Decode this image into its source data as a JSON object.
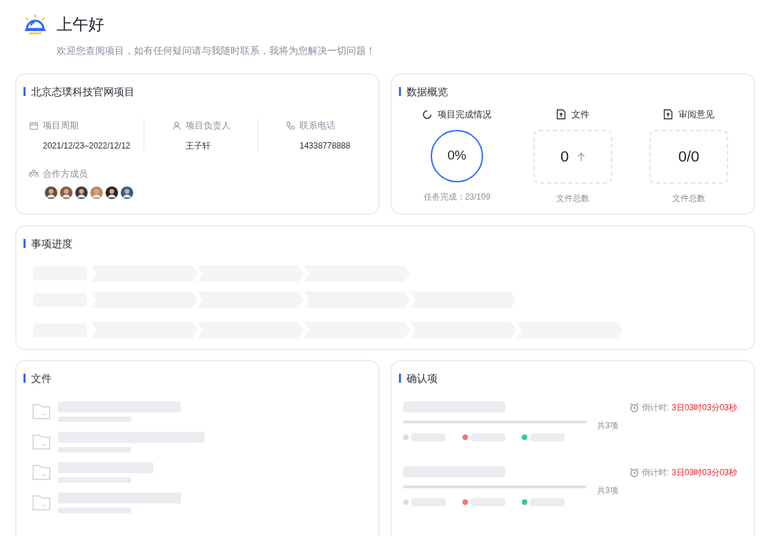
{
  "greeting": {
    "title": "上午好",
    "subtitle": "欢迎您查阅项目，如有任何疑问请与我随时联系，我将为您解决一切问题！"
  },
  "project": {
    "title": "北京态璞科技官网项目",
    "fields": [
      {
        "kind": "calendar",
        "label": "项目周期",
        "value": "2021/12/23–2022/12/12"
      },
      {
        "kind": "person",
        "label": "项目负责人",
        "value": "王子轩"
      },
      {
        "kind": "phone",
        "label": "联系电话",
        "value": "14338778888"
      }
    ],
    "members_label": "合作方成员"
  },
  "overview": {
    "title": "数据概览",
    "completion": {
      "label": "项目完成情况",
      "value": "0%",
      "caption": "任务完成：23/109"
    },
    "files": {
      "label": "文件",
      "value": "0",
      "caption": "文件总数"
    },
    "reviews": {
      "label": "审阅意见",
      "value": "0/0",
      "caption": "文件总数"
    }
  },
  "progress": {
    "title": "事项进度"
  },
  "files": {
    "title": "文件"
  },
  "confirm": {
    "title": "确认项",
    "items": [
      {
        "countdown_label": "倒计时:",
        "countdown": "3日03时03分03秒",
        "total": "共3项"
      },
      {
        "countdown_label": "倒计时:",
        "countdown": "3日03时03分03秒",
        "total": "共3项"
      }
    ],
    "legend": [
      {
        "color": "#d9dce3"
      },
      {
        "color": "#f87171"
      },
      {
        "color": "#34c79c"
      }
    ]
  }
}
